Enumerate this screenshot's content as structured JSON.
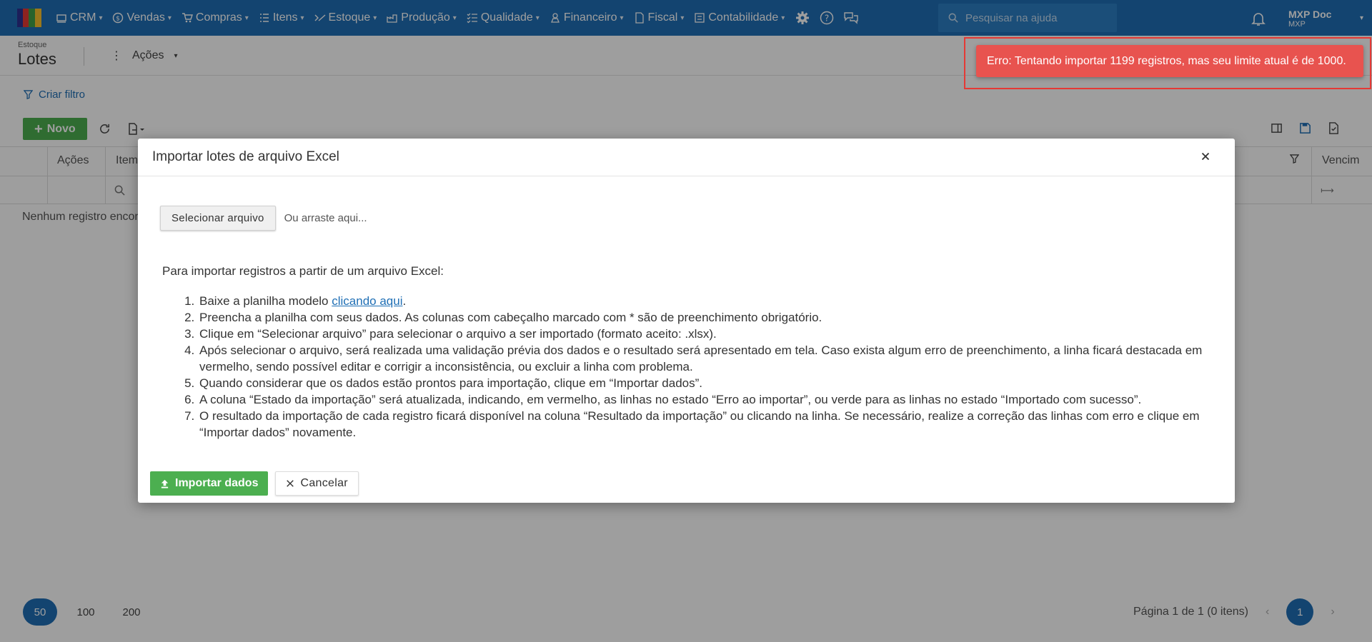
{
  "topnav": {
    "menus": [
      {
        "label": "CRM",
        "icon": "crm-icon"
      },
      {
        "label": "Vendas",
        "icon": "dollar-icon"
      },
      {
        "label": "Compras",
        "icon": "cart-icon"
      },
      {
        "label": "Itens",
        "icon": "items-icon"
      },
      {
        "label": "Estoque",
        "icon": "stock-icon"
      },
      {
        "label": "Produção",
        "icon": "factory-icon"
      },
      {
        "label": "Qualidade",
        "icon": "checklist-icon"
      },
      {
        "label": "Financeiro",
        "icon": "finance-icon"
      },
      {
        "label": "Fiscal",
        "icon": "document-icon"
      },
      {
        "label": "Contabilidade",
        "icon": "calculator-icon"
      }
    ],
    "search_placeholder": "Pesquisar na ajuda",
    "user_name": "MXP Doc",
    "user_org": "MXP",
    "color": "#1f6fb5"
  },
  "page": {
    "breadcrumb": "Estoque",
    "title": "Lotes",
    "actions_label": "Ações",
    "create_filter": "Criar filtro",
    "new_button": "Novo"
  },
  "grid": {
    "columns": [
      "Ações",
      "Item",
      "Vencim"
    ],
    "empty_text": "Nenhum registro encontrado"
  },
  "pager": {
    "sizes": [
      "50",
      "100",
      "200"
    ],
    "active_size": "50",
    "summary": "Página 1 de 1 (0 itens)",
    "current_page": "1"
  },
  "modal": {
    "title": "Importar lotes de arquivo Excel",
    "select_file": "Selecionar arquivo",
    "drop_hint": "Ou arraste aqui...",
    "intro": "Para importar registros a partir de um arquivo Excel:",
    "step1_prefix": "Baixe a planilha modelo ",
    "step1_link": "clicando aqui",
    "step1_suffix": ".",
    "step2": "Preencha a planilha com seus dados. As colunas com cabeçalho marcado com * são de preenchimento obrigatório.",
    "step3": "Clique em “Selecionar arquivo” para selecionar o arquivo a ser importado (formato aceito: .xlsx).",
    "step4": "Após selecionar o arquivo, será realizada uma validação prévia dos dados e o resultado será apresentado em tela. Caso exista algum erro de preenchimento, a linha ficará destacada em vermelho, sendo possível editar e corrigir a inconsistência, ou excluir a linha com problema.",
    "step5": "Quando considerar que os dados estão prontos para importação, clique em “Importar dados”.",
    "step6": "A coluna “Estado da importação” será atualizada, indicando, em vermelho, as linhas no estado “Erro ao importar”, ou verde para as linhas no estado “Importado com sucesso”.",
    "step7": "O resultado da importação de cada registro ficará disponível na coluna “Resultado da importação” ou clicando na linha. Se necessário, realize a correção das linhas com erro e clique em “Importar dados” novamente.",
    "import_button": "Importar dados",
    "cancel_button": "Cancelar"
  },
  "toast": {
    "message": "Erro: Tentando importar 1199 registros, mas seu limite atual é de 1000.",
    "color": "#e8534f"
  }
}
